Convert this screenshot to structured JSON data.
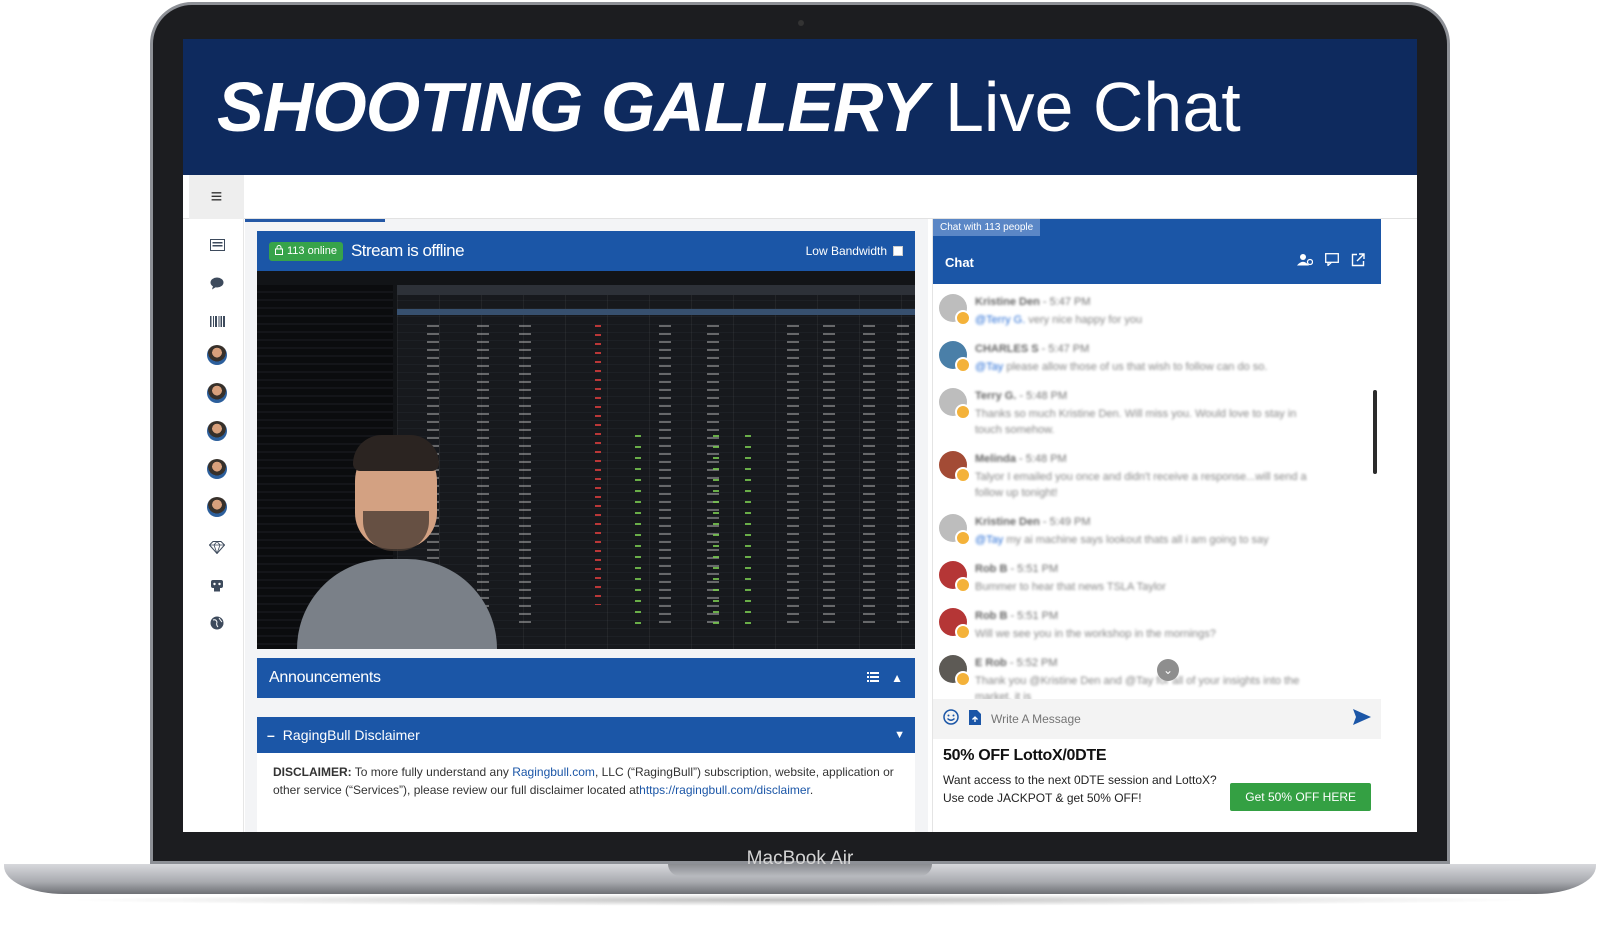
{
  "device": {
    "model": "MacBook Air"
  },
  "banner": {
    "title_bold": "SHOOTING GALLERY",
    "title_light": "Live Chat"
  },
  "sidebar": {
    "items": [
      {
        "icon": "newspaper-icon"
      },
      {
        "icon": "comment-icon"
      },
      {
        "icon": "barcode-icon"
      },
      {
        "icon": "avatar"
      },
      {
        "icon": "avatar"
      },
      {
        "icon": "avatar"
      },
      {
        "icon": "avatar"
      },
      {
        "icon": "avatar"
      },
      {
        "icon": "diamond-icon"
      },
      {
        "icon": "bot-icon"
      },
      {
        "icon": "globe-icon"
      }
    ]
  },
  "stream": {
    "online_badge": "113 online",
    "status": "Stream is offline",
    "bandwidth_label": "Low Bandwidth"
  },
  "announcements": {
    "title": "Announcements"
  },
  "disclaimer": {
    "title": "RagingBull Disclaimer",
    "label": "DISCLAIMER:",
    "text_1": " To more fully understand any ",
    "link_1": "Ragingbull.com",
    "text_2": ", LLC (“RagingBull”) subscription, website, application or other service (“Services”), please review our full disclaimer located at",
    "link_2": "https://ragingbull.com/disclaimer",
    "text_3": "."
  },
  "chat": {
    "count_label": "Chat with 113 people",
    "title": "Chat",
    "messages": [
      {
        "user": "Kristine Den",
        "time": "5:47 PM",
        "mention": "@Terry G.",
        "text": " very nice happy for you"
      },
      {
        "user": "CHARLES S",
        "time": "5:47 PM",
        "mention": "@Tay",
        "text": " please allow those of us that wish to follow can do so."
      },
      {
        "user": "Terry G.",
        "time": "5:48 PM",
        "mention": "",
        "text": "Thanks so much Kristine Den. Will miss you. Would love to stay in touch somehow."
      },
      {
        "user": "Melinda",
        "time": "5:48 PM",
        "mention": "",
        "text": "Talyor I emailed you once and didn't receive a response...will send a follow up tonight!"
      },
      {
        "user": "Kristine Den",
        "time": "5:49 PM",
        "mention": "@Tay",
        "text": " my ai machine says lookout thats all i am going to say"
      },
      {
        "user": "Rob B",
        "time": "5:51 PM",
        "mention": "",
        "text": "Bummer to hear that news TSLA Taylor"
      },
      {
        "user": "Rob B",
        "time": "5:51 PM",
        "mention": "",
        "text": "Will we see you in the workshop in the mornings?"
      },
      {
        "user": "E Rob",
        "time": "5:52 PM",
        "mention": "",
        "text": "Thank you @Kristine Den and @Tay for all of your insights into the market, it is"
      }
    ],
    "composer_placeholder": "Write A Message"
  },
  "promo": {
    "title": "50% OFF LottoX/0DTE",
    "text": "Want access to the next 0DTE session and LottoX? Use code JACKPOT & get 50% OFF!",
    "button": "Get 50% OFF HERE"
  },
  "colors": {
    "navy": "#0e2a5e",
    "primary": "#1b56a7",
    "green": "#34a043",
    "online": "#37a34a"
  }
}
